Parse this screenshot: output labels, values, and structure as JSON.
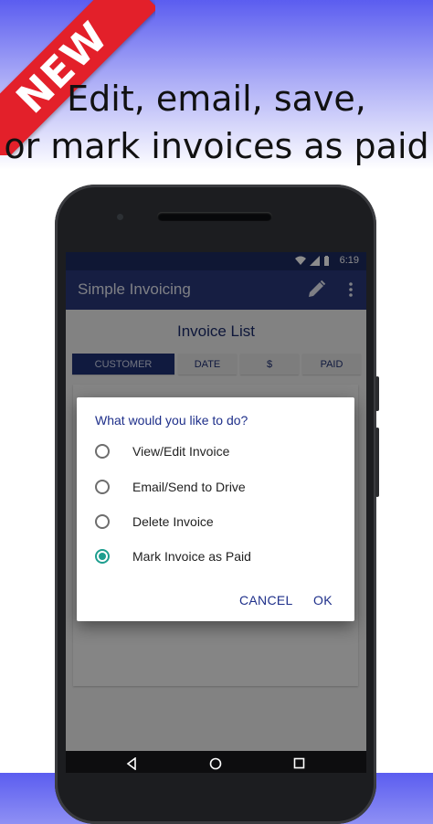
{
  "banner": {
    "label": "NEW"
  },
  "headline": {
    "line1": "Edit, email, save,",
    "line2": "or mark invoices as paid"
  },
  "status_bar": {
    "time": "6:19"
  },
  "app_bar": {
    "title": "Simple Invoicing",
    "icons": [
      "edit-icon",
      "more-vert-icon"
    ]
  },
  "invoice_list": {
    "title": "Invoice List",
    "tabs": [
      {
        "label": "CUSTOMER",
        "active": true
      },
      {
        "label": "DATE",
        "active": false
      },
      {
        "label": "$",
        "active": false
      },
      {
        "label": "PAID",
        "active": false
      }
    ]
  },
  "dialog": {
    "title": "What would you like to do?",
    "options": [
      {
        "label": "View/Edit Invoice",
        "selected": false
      },
      {
        "label": "Email/Send to Drive",
        "selected": false
      },
      {
        "label": "Delete Invoice",
        "selected": false
      },
      {
        "label": "Mark Invoice as Paid",
        "selected": true
      }
    ],
    "cancel_label": "CANCEL",
    "ok_label": "OK"
  },
  "colors": {
    "app_bar": "#283878",
    "accent": "#1e9e8f",
    "banner": "#e3202a",
    "dialog_text": "#1e2f8a"
  }
}
